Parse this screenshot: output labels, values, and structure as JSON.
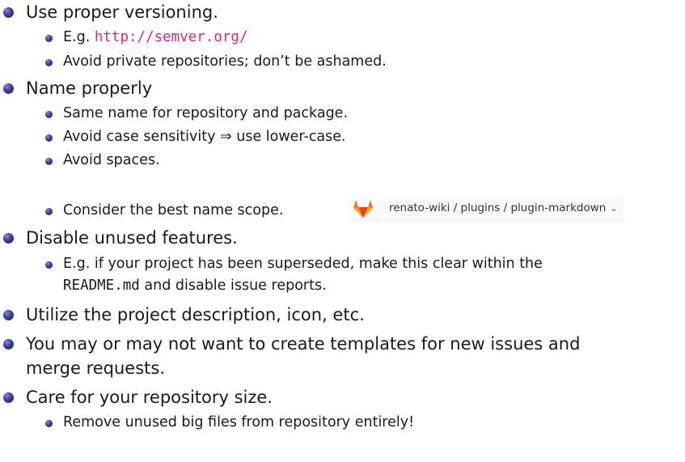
{
  "items": [
    {
      "text": "Use proper versioning."
    },
    {
      "prefix": "E.g. ",
      "link": "http://semver.org/"
    },
    {
      "text": "Avoid private repositories; don’t be ashamed."
    },
    {
      "text": "Name properly"
    },
    {
      "text": "Same name for repository and package."
    },
    {
      "text": "Avoid case sensitivity ⇒ use lower-case."
    },
    {
      "text": "Avoid spaces."
    },
    {
      "text": "Consider the best name scope."
    },
    {
      "text": "Disable unused features."
    },
    {
      "line1": "E.g. if your project has been superseded, make this clear within the",
      "code": "README.md",
      "line2_suffix": " and disable issue reports."
    },
    {
      "text": "Utilize the project description, icon, etc."
    },
    {
      "line1": "You may or may not want to create templates for new issues and",
      "line2": "merge requests."
    },
    {
      "text": "Care for your repository size."
    },
    {
      "text": "Remove unused big files from repository entirely!"
    }
  ],
  "gitlab_breadcrumb": {
    "path": "renato-wiki / plugins / plugin-markdown",
    "icon": "gitlab-logo-icon",
    "chevron": "chevron-down-icon"
  },
  "colors": {
    "bullet": "#3b3b9a",
    "link": "#d6297a",
    "text": "#1a1a1a"
  }
}
